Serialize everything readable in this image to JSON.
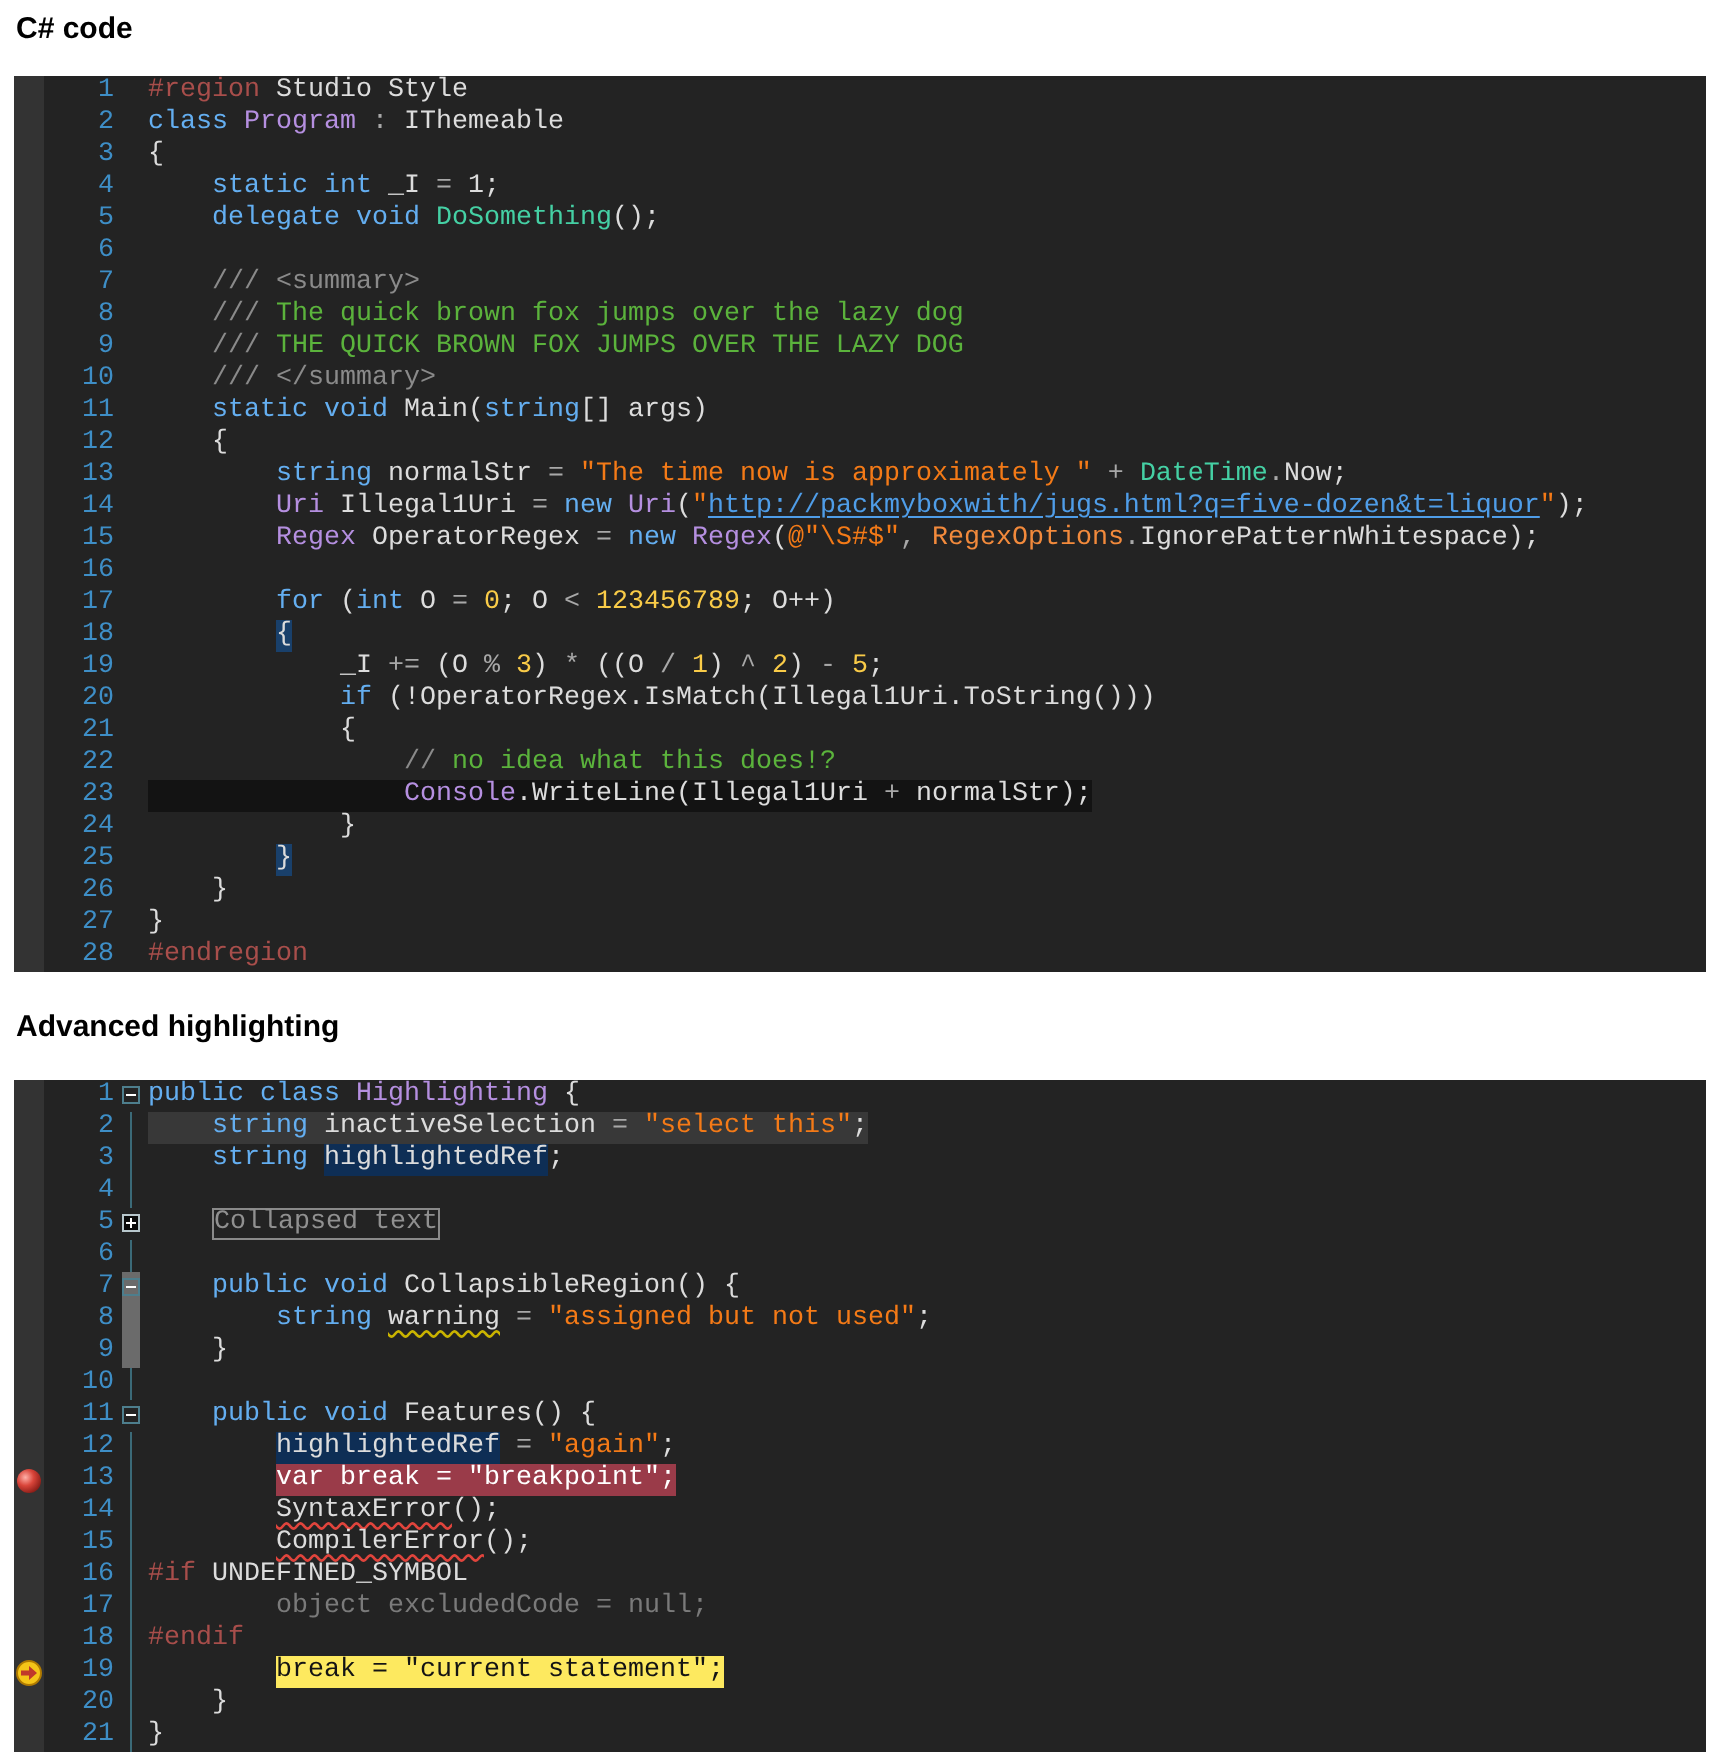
{
  "sections": [
    {
      "heading": "C# code",
      "folding": false,
      "lines": [
        {
          "number": "1",
          "tokens": [
            {
              "text": "#region",
              "kind": "preproc"
            },
            {
              "text": " Studio Style",
              "kind": "plain"
            }
          ]
        },
        {
          "number": "2",
          "tokens": [
            {
              "text": "class ",
              "kind": "keyword"
            },
            {
              "text": "Program",
              "kind": "type"
            },
            {
              "text": " : ",
              "kind": "operator"
            },
            {
              "text": "IThemeable",
              "kind": "plain"
            }
          ]
        },
        {
          "number": "3",
          "tokens": [
            {
              "text": "{",
              "kind": "plain"
            }
          ]
        },
        {
          "number": "4",
          "tokens": [
            {
              "text": "    static int",
              "kind": "keyword"
            },
            {
              "text": " _I ",
              "kind": "plain"
            },
            {
              "text": "=",
              "kind": "operator"
            },
            {
              "text": " 1;",
              "kind": "plain"
            }
          ]
        },
        {
          "number": "5",
          "tokens": [
            {
              "text": "    delegate void",
              "kind": "keyword"
            },
            {
              "text": " DoSomething",
              "kind": "method"
            },
            {
              "text": "();",
              "kind": "plain"
            }
          ]
        },
        {
          "number": "6"
        },
        {
          "number": "7",
          "tokens": [
            {
              "text": "    /// <summary>",
              "kind": "doctag"
            }
          ]
        },
        {
          "number": "8",
          "tokens": [
            {
              "text": "    ///",
              "kind": "doctag"
            },
            {
              "text": " The quick brown fox jumps over the lazy dog",
              "kind": "comment"
            }
          ]
        },
        {
          "number": "9",
          "tokens": [
            {
              "text": "    ///",
              "kind": "doctag"
            },
            {
              "text": " THE QUICK BROWN FOX JUMPS OVER THE LAZY DOG",
              "kind": "comment"
            }
          ]
        },
        {
          "number": "10",
          "tokens": [
            {
              "text": "    /// </summary>",
              "kind": "doctag"
            }
          ]
        },
        {
          "number": "11",
          "tokens": [
            {
              "text": "    static void",
              "kind": "keyword"
            },
            {
              "text": " Main(",
              "kind": "plain"
            },
            {
              "text": "string",
              "kind": "keyword"
            },
            {
              "text": "[] args)",
              "kind": "plain"
            }
          ]
        },
        {
          "number": "12",
          "tokens": [
            {
              "text": "    {",
              "kind": "plain"
            }
          ]
        },
        {
          "number": "13",
          "tokens": [
            {
              "text": "        string",
              "kind": "keyword"
            },
            {
              "text": " normalStr ",
              "kind": "plain"
            },
            {
              "text": "= ",
              "kind": "operator"
            },
            {
              "text": "\"The time now is approximately \"",
              "kind": "string"
            },
            {
              "text": " + ",
              "kind": "operator"
            },
            {
              "text": "DateTime",
              "kind": "method"
            },
            {
              "text": ".",
              "kind": "operator"
            },
            {
              "text": "Now;",
              "kind": "plain"
            }
          ]
        },
        {
          "number": "14",
          "tokens": [
            {
              "text": "        Uri",
              "kind": "type"
            },
            {
              "text": " Illegal1Uri ",
              "kind": "plain"
            },
            {
              "text": "=",
              "kind": "operator"
            },
            {
              "text": " new ",
              "kind": "keyword"
            },
            {
              "text": "Uri",
              "kind": "type"
            },
            {
              "text": "(",
              "kind": "plain"
            },
            {
              "text": "\"",
              "kind": "string"
            },
            {
              "text": "http://packmyboxwith/jugs.html?q=five-dozen&t=liquor",
              "kind": "url"
            },
            {
              "text": "\"",
              "kind": "string"
            },
            {
              "text": ");",
              "kind": "plain"
            }
          ]
        },
        {
          "number": "15",
          "tokens": [
            {
              "text": "        Regex",
              "kind": "type"
            },
            {
              "text": " OperatorRegex ",
              "kind": "plain"
            },
            {
              "text": "=",
              "kind": "operator"
            },
            {
              "text": " new ",
              "kind": "keyword"
            },
            {
              "text": "Regex",
              "kind": "type"
            },
            {
              "text": "(",
              "kind": "plain"
            },
            {
              "text": "@\"\\S#$\"",
              "kind": "string"
            },
            {
              "text": ", ",
              "kind": "operator"
            },
            {
              "text": "RegexOptions",
              "kind": "enum"
            },
            {
              "text": ".",
              "kind": "operator"
            },
            {
              "text": "IgnorePatternWhitespace);",
              "kind": "plain"
            }
          ]
        },
        {
          "number": "16"
        },
        {
          "number": "17",
          "tokens": [
            {
              "text": "        for",
              "kind": "keyword"
            },
            {
              "text": " (",
              "kind": "plain"
            },
            {
              "text": "int",
              "kind": "keyword"
            },
            {
              "text": " O ",
              "kind": "plain"
            },
            {
              "text": "= ",
              "kind": "operator"
            },
            {
              "text": "0",
              "kind": "number"
            },
            {
              "text": "; O ",
              "kind": "plain"
            },
            {
              "text": "< ",
              "kind": "operator"
            },
            {
              "text": "123456789",
              "kind": "number"
            },
            {
              "text": "; O++)",
              "kind": "plain"
            }
          ]
        },
        {
          "number": "18",
          "tokens": [
            {
              "text": "        {",
              "kind": "plain",
              "matched": true
            }
          ]
        },
        {
          "number": "19",
          "tokens": [
            {
              "text": "            _I ",
              "kind": "plain"
            },
            {
              "text": "+=",
              "kind": "operator"
            },
            {
              "text": " (O ",
              "kind": "plain"
            },
            {
              "text": "% ",
              "kind": "operator"
            },
            {
              "text": "3",
              "kind": "number"
            },
            {
              "text": ") ",
              "kind": "plain"
            },
            {
              "text": "*",
              "kind": "operator"
            },
            {
              "text": " ((O ",
              "kind": "plain"
            },
            {
              "text": "/ ",
              "kind": "operator"
            },
            {
              "text": "1",
              "kind": "number"
            },
            {
              "text": ") ",
              "kind": "plain"
            },
            {
              "text": "^ ",
              "kind": "operator"
            },
            {
              "text": "2",
              "kind": "number"
            },
            {
              "text": ") ",
              "kind": "plain"
            },
            {
              "text": "- ",
              "kind": "operator"
            },
            {
              "text": "5",
              "kind": "number"
            },
            {
              "text": ";",
              "kind": "plain"
            }
          ]
        },
        {
          "number": "20",
          "tokens": [
            {
              "text": "            if",
              "kind": "keyword"
            },
            {
              "text": " (!OperatorRegex.IsMatch(Illegal1Uri.ToString()))",
              "kind": "plain"
            }
          ]
        },
        {
          "number": "21",
          "tokens": [
            {
              "text": "            {",
              "kind": "plain"
            }
          ]
        },
        {
          "number": "22",
          "tokens": [
            {
              "text": "                //",
              "kind": "doctag"
            },
            {
              "text": " no idea what this does!?",
              "kind": "comment"
            }
          ]
        },
        {
          "number": "23",
          "current_line": true,
          "tokens": [
            {
              "text": "                Console",
              "kind": "type"
            },
            {
              "text": ".WriteLine(Illegal1Uri ",
              "kind": "plain"
            },
            {
              "text": "+",
              "kind": "operator"
            },
            {
              "text": " normalStr);",
              "kind": "plain"
            }
          ]
        },
        {
          "number": "24",
          "tokens": [
            {
              "text": "            }",
              "kind": "plain"
            }
          ]
        },
        {
          "number": "25",
          "tokens": [
            {
              "text": "        }",
              "kind": "plain",
              "matched": true
            }
          ]
        },
        {
          "number": "26",
          "tokens": [
            {
              "text": "    }",
              "kind": "plain"
            }
          ]
        },
        {
          "number": "27",
          "tokens": [
            {
              "text": "}",
              "kind": "plain"
            }
          ]
        },
        {
          "number": "28",
          "tokens": [
            {
              "text": "#endregion",
              "kind": "preproc"
            }
          ]
        }
      ]
    },
    {
      "heading": "Advanced highlighting",
      "folding": true,
      "lines": [
        {
          "number": "1",
          "expanded": true,
          "tokens": [
            {
              "text": "public class ",
              "kind": "keyword"
            },
            {
              "text": "Highlighting",
              "kind": "type"
            },
            {
              "text": " {",
              "kind": "plain"
            }
          ]
        },
        {
          "number": "2",
          "inactive_selection": true,
          "tokens": [
            {
              "text": "    string",
              "kind": "keyword"
            },
            {
              "text": " inactiveSelection ",
              "kind": "plain"
            },
            {
              "text": "= ",
              "kind": "operator"
            },
            {
              "text": "\"select this\"",
              "kind": "string"
            },
            {
              "text": ";",
              "kind": "plain"
            }
          ]
        },
        {
          "number": "3",
          "tokens": [
            {
              "text": "    string ",
              "kind": "keyword"
            },
            {
              "text": "highlightedRef",
              "kind": "plain",
              "referenced": true
            },
            {
              "text": ";",
              "kind": "plain"
            }
          ]
        },
        {
          "number": "4"
        },
        {
          "number": "5",
          "expanded": false,
          "tokens": [
            {
              "text": "    Collapsed text",
              "kind": "collapsed"
            }
          ]
        },
        {
          "number": "6"
        },
        {
          "number": "7",
          "expanded": true,
          "hover": true,
          "tokens": [
            {
              "text": "    public void",
              "kind": "keyword"
            },
            {
              "text": " CollapsibleRegion() {",
              "kind": "plain"
            }
          ]
        },
        {
          "number": "8",
          "hover": true,
          "tokens": [
            {
              "text": "        string ",
              "kind": "keyword"
            },
            {
              "text": "warning",
              "kind": "plain",
              "warning": true
            },
            {
              "text": " = ",
              "kind": "operator"
            },
            {
              "text": "\"assigned but not used\"",
              "kind": "string"
            },
            {
              "text": ";",
              "kind": "plain"
            }
          ]
        },
        {
          "number": "9",
          "hover": true,
          "tokens": [
            {
              "text": "    }",
              "kind": "plain"
            }
          ]
        },
        {
          "number": "10"
        },
        {
          "number": "11",
          "expanded": true,
          "tokens": [
            {
              "text": "    public void",
              "kind": "keyword"
            },
            {
              "text": " Features() {",
              "kind": "plain"
            }
          ]
        },
        {
          "number": "12",
          "tokens": [
            {
              "text": "        highlightedRef",
              "kind": "plain",
              "referenced": true
            },
            {
              "text": " = ",
              "kind": "operator"
            },
            {
              "text": "\"again\"",
              "kind": "string"
            },
            {
              "text": ";",
              "kind": "plain"
            }
          ]
        },
        {
          "number": "13",
          "breakpoint": true,
          "tokens": [
            {
              "text": "        var break = \"breakpoint\";",
              "kind": "plain"
            }
          ]
        },
        {
          "number": "14",
          "tokens": [
            {
              "text": "        SyntaxError",
              "kind": "plain",
              "error": true
            },
            {
              "text": "();",
              "kind": "plain"
            }
          ]
        },
        {
          "number": "15",
          "tokens": [
            {
              "text": "        CompilerError",
              "kind": "plain",
              "error": true
            },
            {
              "text": "();",
              "kind": "plain"
            }
          ]
        },
        {
          "number": "16",
          "tokens": [
            {
              "text": "#if",
              "kind": "preproc"
            },
            {
              "text": " UNDEFINED_SYMBOL",
              "kind": "plain"
            }
          ]
        },
        {
          "number": "17",
          "tokens": [
            {
              "text": "        object excludedCode = null;",
              "kind": "excluded"
            }
          ]
        },
        {
          "number": "18",
          "tokens": [
            {
              "text": "#endif",
              "kind": "preproc"
            }
          ]
        },
        {
          "number": "19",
          "current": true,
          "tokens": [
            {
              "text": "        break = \"current statement\";",
              "kind": "plain"
            }
          ]
        },
        {
          "number": "20",
          "tokens": [
            {
              "text": "    }",
              "kind": "plain"
            }
          ]
        },
        {
          "number": "21",
          "tokens": [
            {
              "text": "}",
              "kind": "plain"
            }
          ]
        }
      ]
    }
  ]
}
